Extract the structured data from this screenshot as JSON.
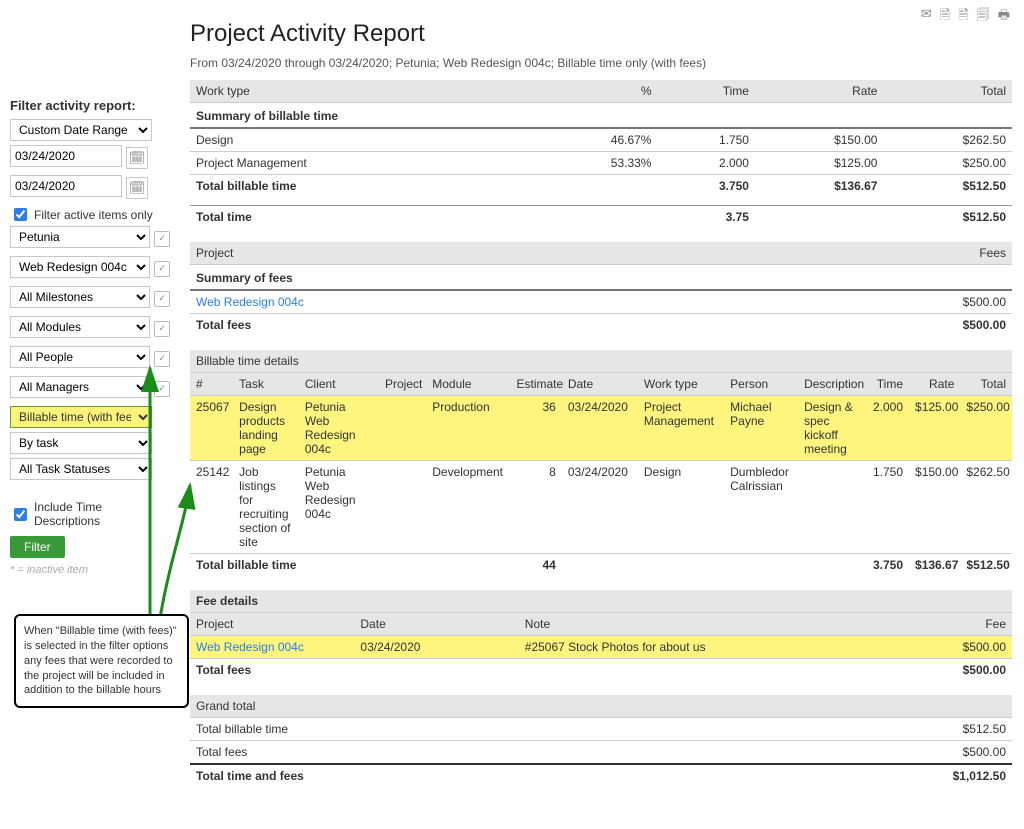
{
  "report": {
    "title": "Project Activity Report",
    "subtitle": "From 03/24/2020 through 03/24/2020; Petunia; Web Redesign 004c; Billable time only (with fees)"
  },
  "toolbar_icons": [
    "envelope",
    "excel",
    "pdf",
    "word",
    "print"
  ],
  "sidebar": {
    "title": "Filter activity report:",
    "date_range_select": "Custom Date Range",
    "date_from": "03/24/2020",
    "date_to": "03/24/2020",
    "active_only_label": "Filter active items only",
    "selects": {
      "client": "Petunia",
      "project": "Web Redesign 004c",
      "milestones": "All Milestones",
      "modules": "All Modules",
      "people": "All People",
      "managers": "All Managers",
      "billable": "Billable time (with fees)",
      "grouping": "By task",
      "status": "All Task Statuses"
    },
    "include_desc_label": "Include Time Descriptions",
    "filter_btn": "Filter",
    "inactive_hint": "* = inactive item"
  },
  "summary": {
    "header": {
      "worktype": "Work type",
      "pct": "%",
      "time": "Time",
      "rate": "Rate",
      "total": "Total"
    },
    "section": "Summary of billable time",
    "rows": [
      {
        "name": "Design",
        "pct": "46.67%",
        "time": "1.750",
        "rate": "$150.00",
        "total": "$262.50"
      },
      {
        "name": "Project Management",
        "pct": "53.33%",
        "time": "2.000",
        "rate": "$125.00",
        "total": "$250.00"
      }
    ],
    "tot_billable": {
      "label": "Total billable time",
      "time": "3.750",
      "rate": "$136.67",
      "total": "$512.50"
    },
    "tot_time": {
      "label": "Total time",
      "time": "3.75",
      "total": "$512.50"
    }
  },
  "fees_summary": {
    "header_project": "Project",
    "header_fees": "Fees",
    "section": "Summary of fees",
    "row": {
      "name": "Web Redesign 004c",
      "total": "$500.00"
    },
    "total": {
      "label": "Total fees",
      "val": "$500.00"
    }
  },
  "details": {
    "section": "Billable time details",
    "cols": {
      "num": "#",
      "task": "Task",
      "client": "Client",
      "project": "Project",
      "module": "Module",
      "estimate": "Estimate",
      "date": "Date",
      "worktype": "Work type",
      "person": "Person",
      "desc": "Description",
      "time": "Time",
      "rate": "Rate",
      "total": "Total"
    },
    "rows": [
      {
        "num": "25067",
        "task": "Design products landing page",
        "client": "Petunia\nWeb Redesign 004c",
        "module": "Production",
        "estimate": "36",
        "date": "03/24/2020",
        "worktype": "Project Management",
        "person": "Michael Payne",
        "desc": "Design & spec kickoff meeting",
        "time": "2.000",
        "rate": "$125.00",
        "total": "$250.00",
        "hl": true
      },
      {
        "num": "25142",
        "task": "Job listings for recruiting section of site",
        "client": "Petunia\nWeb Redesign 004c",
        "module": "Development",
        "estimate": "8",
        "date": "03/24/2020",
        "worktype": "Design",
        "person": "Dumbledor Calrissian",
        "desc": "",
        "time": "1.750",
        "rate": "$150.00",
        "total": "$262.50",
        "hl": false
      }
    ],
    "total": {
      "label": "Total billable time",
      "estimate": "44",
      "time": "3.750",
      "rate": "$136.67",
      "total": "$512.50"
    }
  },
  "fee_details": {
    "section": "Fee details",
    "cols": {
      "project": "Project",
      "date": "Date",
      "note": "Note",
      "fee": "Fee"
    },
    "row": {
      "project": "Web Redesign 004c",
      "date": "03/24/2020",
      "note": "#25067 Stock Photos for about us",
      "fee": "$500.00"
    },
    "total": {
      "label": "Total fees",
      "val": "$500.00"
    }
  },
  "grand": {
    "section": "Grand total",
    "billable": {
      "label": "Total billable time",
      "val": "$512.50"
    },
    "fees": {
      "label": "Total fees",
      "val": "$500.00"
    },
    "total": {
      "label": "Total time and fees",
      "val": "$1,012.50"
    }
  },
  "callout": "When \"Billable time (with fees)\" is selected in the filter options any fees that were recorded to the project will be included in addition to the billable hours"
}
